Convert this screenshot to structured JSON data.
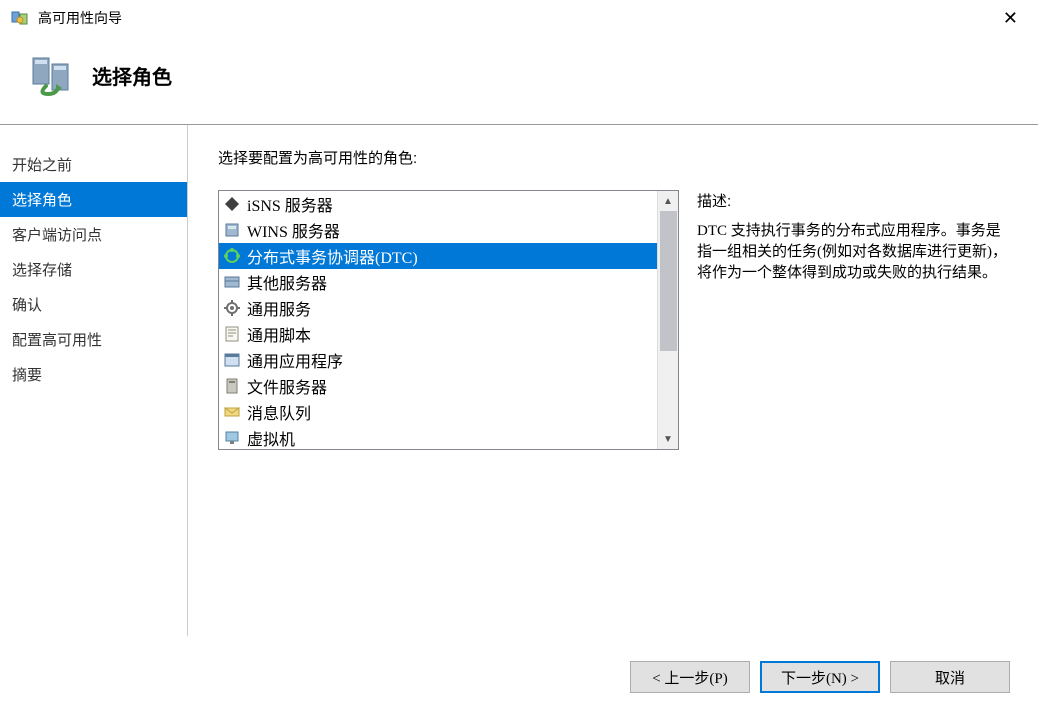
{
  "window": {
    "title": "高可用性向导",
    "close_label": "✕"
  },
  "header": {
    "title": "选择角色"
  },
  "sidebar": {
    "items": [
      {
        "label": "开始之前"
      },
      {
        "label": "选择角色"
      },
      {
        "label": "客户端访问点"
      },
      {
        "label": "选择存储"
      },
      {
        "label": "确认"
      },
      {
        "label": "配置高可用性"
      },
      {
        "label": "摘要"
      }
    ],
    "active_index": 1
  },
  "content": {
    "instruction": "选择要配置为高可用性的角色:"
  },
  "roles": {
    "items": [
      {
        "label": "iSNS 服务器",
        "icon": "isns"
      },
      {
        "label": "WINS 服务器",
        "icon": "wins"
      },
      {
        "label": "分布式事务协调器(DTC)",
        "icon": "dtc"
      },
      {
        "label": "其他服务器",
        "icon": "other"
      },
      {
        "label": "通用服务",
        "icon": "service"
      },
      {
        "label": "通用脚本",
        "icon": "script"
      },
      {
        "label": "通用应用程序",
        "icon": "app"
      },
      {
        "label": "文件服务器",
        "icon": "file"
      },
      {
        "label": "消息队列",
        "icon": "queue"
      },
      {
        "label": "虚拟机",
        "icon": "vm"
      }
    ],
    "selected_index": 2
  },
  "description": {
    "label": "描述:",
    "text": "DTC 支持执行事务的分布式应用程序。事务是指一组相关的任务(例如对各数据库进行更新)，将作为一个整体得到成功或失败的执行结果。"
  },
  "buttons": {
    "prev": "< 上一步(P)",
    "next": "下一步(N) >",
    "cancel": "取消"
  },
  "icons": {
    "scroll_up": "▲",
    "scroll_down": "▼"
  }
}
